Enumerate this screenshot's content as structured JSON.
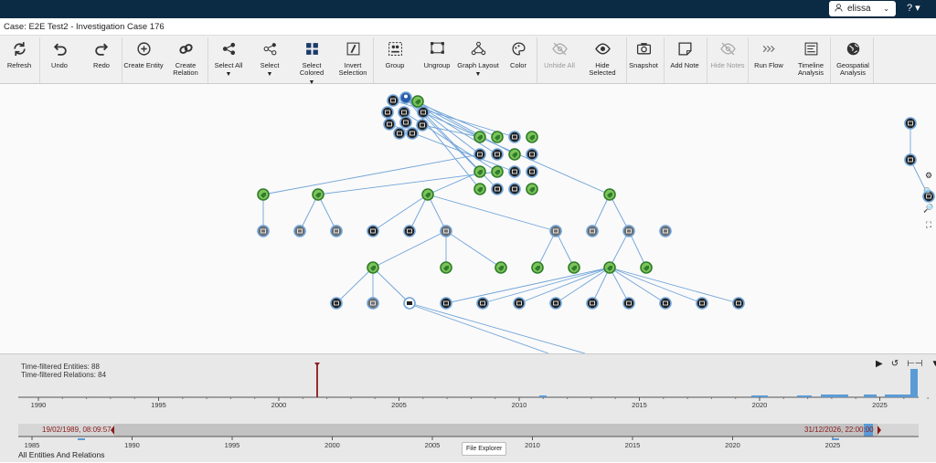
{
  "header": {
    "user": "elissa",
    "help": "?"
  },
  "case_title": "Case: E2E Test2 - Investigation Case 176",
  "toolbar": [
    {
      "id": "refresh",
      "label": "Refresh",
      "icon": "refresh-icon"
    },
    {
      "id": "undo",
      "label": "Undo",
      "icon": "undo-icon"
    },
    {
      "id": "redo",
      "label": "Redo",
      "icon": "redo-icon"
    },
    {
      "id": "create-entity",
      "label": "Create Entity",
      "icon": "plus-circle-icon"
    },
    {
      "id": "create-relation",
      "label": "Create Relation",
      "icon": "link-icon"
    },
    {
      "id": "select-all",
      "label": "Select All",
      "icon": "share-nodes-icon",
      "dropdown": true
    },
    {
      "id": "select",
      "label": "Select",
      "icon": "share-outline-icon",
      "dropdown": true
    },
    {
      "id": "select-colored",
      "label": "Select Colored",
      "icon": "grid-icon",
      "dropdown": true
    },
    {
      "id": "invert-selection",
      "label": "Invert Selection",
      "icon": "invert-icon"
    },
    {
      "id": "group",
      "label": "Group",
      "icon": "group-icon"
    },
    {
      "id": "ungroup",
      "label": "Ungroup",
      "icon": "ungroup-icon"
    },
    {
      "id": "graph-layout",
      "label": "Graph Layout",
      "icon": "layout-icon",
      "dropdown": true
    },
    {
      "id": "color",
      "label": "Color",
      "icon": "palette-icon"
    },
    {
      "id": "unhide-all",
      "label": "Unhide All",
      "icon": "eye-off-icon",
      "disabled": true
    },
    {
      "id": "hide-selected",
      "label": "Hide Selected",
      "icon": "eye-icon"
    },
    {
      "id": "snapshot",
      "label": "Snapshot",
      "icon": "camera-icon"
    },
    {
      "id": "add-note",
      "label": "Add Note",
      "icon": "note-icon"
    },
    {
      "id": "hide-notes",
      "label": "Hide Notes",
      "icon": "eye-off-icon",
      "disabled": true
    },
    {
      "id": "run-flow",
      "label": "Run Flow",
      "icon": "flow-icon"
    },
    {
      "id": "timeline-analysis",
      "label": "Timeline Analysis",
      "icon": "timeline-icon"
    },
    {
      "id": "geospatial-analysis",
      "label": "Geospatial Analysis",
      "icon": "globe-icon"
    }
  ],
  "side_tools": [
    "gear-icon",
    "zoom-in-icon",
    "zoom-out-icon",
    "fit-icon"
  ],
  "timeline": {
    "entities": "Time-filtered Entities: 88",
    "relations": "Time-filtered Relations: 84",
    "upper_years": [
      "1990",
      "1995",
      "2000",
      "2005",
      "2010",
      "2015",
      "2020",
      "2025"
    ],
    "lower_years": [
      "1985",
      "1990",
      "1995",
      "2000",
      "2005",
      "2010",
      "2015",
      "2020",
      "2025"
    ],
    "range_start": "19/02/1989, 08:09:57",
    "range_end": "31/12/2026, 22:00:00",
    "tooltip": "File Explorer",
    "footer": "All Entities And Relations"
  },
  "colors": {
    "topbar": "#0b2a44",
    "edge": "#6fa3d8",
    "green": "#3a8a2e",
    "marker": "#8a1a1a",
    "bar": "#5b9bd5"
  }
}
